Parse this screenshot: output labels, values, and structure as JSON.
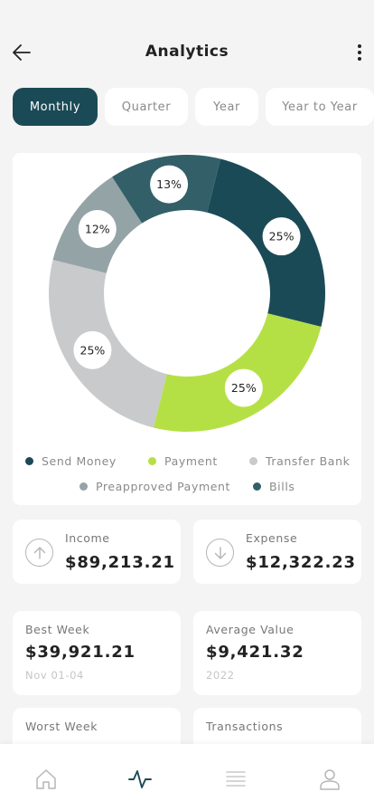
{
  "header": {
    "title": "Analytics"
  },
  "tabs": [
    {
      "label": "Monthly",
      "active": true
    },
    {
      "label": "Quarter",
      "active": false
    },
    {
      "label": "Year",
      "active": false
    },
    {
      "label": "Year to Year",
      "active": false
    }
  ],
  "chart_data": {
    "type": "pie",
    "style": "donut",
    "slices": [
      {
        "label": "Send Money",
        "value": 25,
        "display": "25%",
        "color": "#1b4a57"
      },
      {
        "label": "Payment",
        "value": 25,
        "display": "25%",
        "color": "#b5e045"
      },
      {
        "label": "Transfer Bank",
        "value": 25,
        "display": "25%",
        "color": "#c8cacb"
      },
      {
        "label": "Preapproved Payment",
        "value": 12,
        "display": "12%",
        "color": "#94a3a6"
      },
      {
        "label": "Bills",
        "value": 13,
        "display": "13%",
        "color": "#335f69"
      }
    ],
    "legend_position": "bottom"
  },
  "legend": [
    {
      "label": "Send Money",
      "color": "#1b4a57"
    },
    {
      "label": "Payment",
      "color": "#b5e045"
    },
    {
      "label": "Transfer Bank",
      "color": "#c8cacb"
    },
    {
      "label": "Preapproved Payment",
      "color": "#94a3a6"
    },
    {
      "label": "Bills",
      "color": "#335f69"
    }
  ],
  "income": {
    "label": "Income",
    "value": "$89,213.21",
    "icon": "arrow-up-circle-icon"
  },
  "expense": {
    "label": "Expense",
    "value": "$12,322.23",
    "icon": "arrow-down-circle-icon"
  },
  "best_week": {
    "label": "Best Week",
    "value": "$39,921.21",
    "sub": "Nov 01-04"
  },
  "average_value": {
    "label": "Average Value",
    "value": "$9,421.32",
    "sub": "2022"
  },
  "worst_week": {
    "label": "Worst Week"
  },
  "transactions": {
    "label": "Transactions"
  },
  "nav": {
    "items": [
      {
        "icon": "home-icon",
        "active": false
      },
      {
        "icon": "activity-icon",
        "active": true
      },
      {
        "icon": "list-icon",
        "active": false
      },
      {
        "icon": "profile-icon",
        "active": false
      }
    ]
  },
  "colors": {
    "accent": "#1b4a57",
    "background": "#f4f4f4"
  }
}
